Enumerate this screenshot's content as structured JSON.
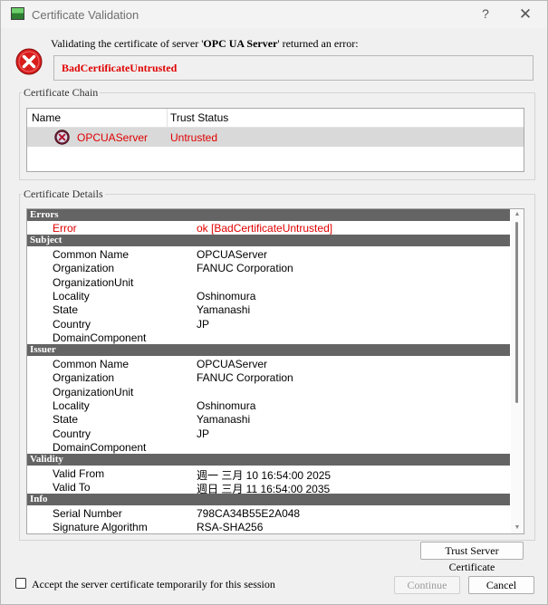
{
  "window": {
    "title": "Certificate Validation",
    "help_glyph": "?",
    "close_glyph": "✕"
  },
  "error": {
    "message_prefix": "Validating the certificate of server '",
    "server_name": "OPC UA Server",
    "message_suffix": "' returned an error:",
    "code": "BadCertificateUntrusted"
  },
  "chain": {
    "group_label": "Certificate Chain",
    "columns": {
      "name": "Name",
      "trust": "Trust Status"
    },
    "rows": [
      {
        "name": "OPCUAServer",
        "trust": "Untrusted"
      }
    ]
  },
  "details": {
    "group_label": "Certificate Details",
    "sections": {
      "errors": "Errors",
      "subject": "Subject",
      "issuer": "Issuer",
      "validity": "Validity",
      "info": "Info"
    },
    "errors": {
      "error_key": "Error",
      "error_value": "ok [BadCertificateUntrusted]"
    },
    "subject": {
      "common_name_key": "Common Name",
      "common_name": "OPCUAServer",
      "organization_key": "Organization",
      "organization": "FANUC Corporation",
      "org_unit_key": "OrganizationUnit",
      "org_unit": "",
      "locality_key": "Locality",
      "locality": "Oshinomura",
      "state_key": "State",
      "state": "Yamanashi",
      "country_key": "Country",
      "country": "JP",
      "domain_key": "DomainComponent",
      "domain": ""
    },
    "issuer": {
      "common_name_key": "Common Name",
      "common_name": "OPCUAServer",
      "organization_key": "Organization",
      "organization": "FANUC Corporation",
      "org_unit_key": "OrganizationUnit",
      "org_unit": "",
      "locality_key": "Locality",
      "locality": "Oshinomura",
      "state_key": "State",
      "state": "Yamanashi",
      "country_key": "Country",
      "country": "JP",
      "domain_key": "DomainComponent",
      "domain": ""
    },
    "validity": {
      "valid_from_key": "Valid From",
      "valid_from": "週一 三月 10 16:54:00 2025",
      "valid_to_key": "Valid To",
      "valid_to": "週日 三月 11 16:54:00 2035"
    },
    "info": {
      "serial_key": "Serial Number",
      "serial": "798CA34B55E2A048",
      "sig_key": "Signature Algorithm",
      "sig": "RSA-SHA256"
    }
  },
  "buttons": {
    "trust": "Trust Server Certificate",
    "continue": "Continue",
    "cancel": "Cancel"
  },
  "accept_temp_label": "Accept the server certificate temporarily for this session",
  "colors": {
    "error_red": "#e00000",
    "section_bg": "#646464"
  }
}
